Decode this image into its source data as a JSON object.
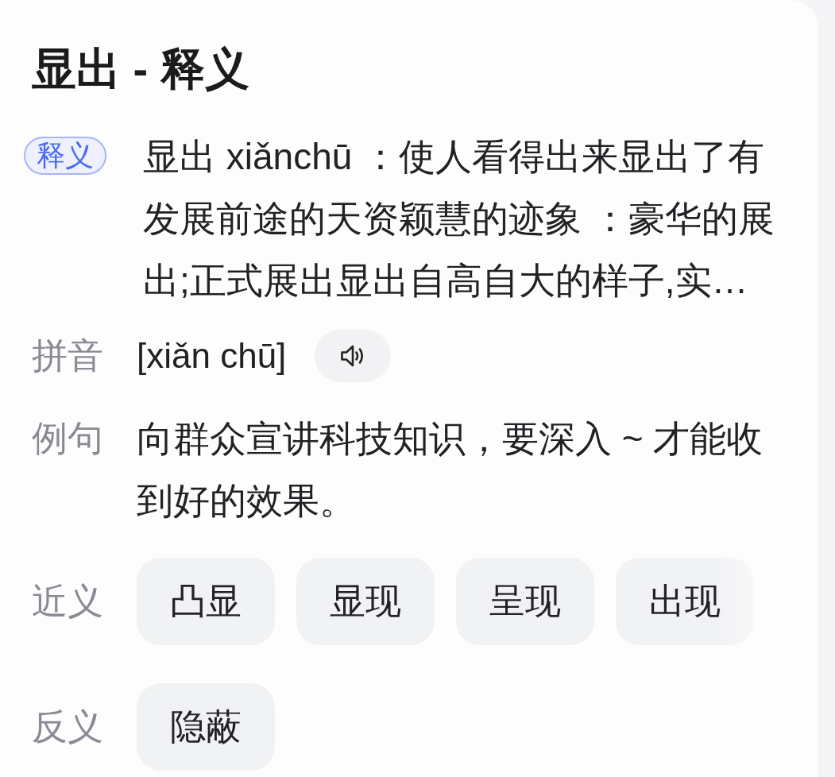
{
  "title": "显出 - 释义",
  "sections": [
    {
      "kind": "definition",
      "badge": "释义",
      "text": "显出 xiǎnchū ：使人看得出来显出了有发展前途的天资颖慧的迹象 ：豪华的展出;正式展出显出自高自大的样子,实…"
    },
    {
      "kind": "pinyin",
      "label": "拼音",
      "text": "[xiǎn chū]"
    },
    {
      "kind": "example",
      "label": "例句",
      "text": "向群众宣讲科技知识，要深入 ~ 才能收到好的效果。"
    },
    {
      "kind": "chips",
      "label": "近义",
      "items": [
        "凸显",
        "显现",
        "呈现",
        "出现"
      ]
    },
    {
      "kind": "chips",
      "label": "反义",
      "items": [
        "隐蔽"
      ]
    }
  ]
}
